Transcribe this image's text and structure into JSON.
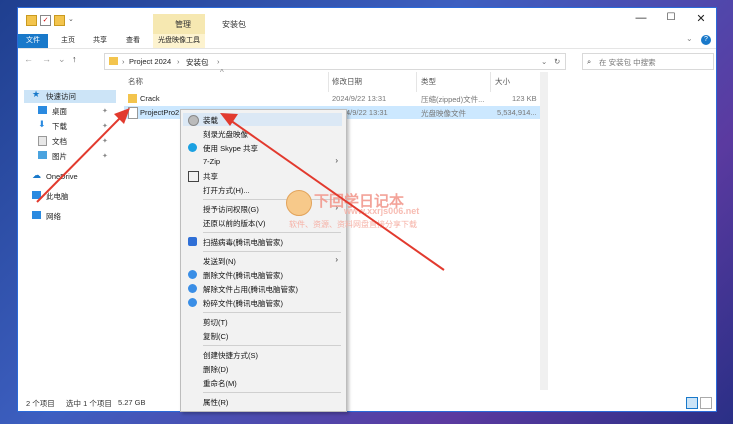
{
  "titlebar": {
    "ribbon_context_tab": "管理",
    "window_title": "安装包",
    "minimize": "—",
    "maximize": "☐",
    "close": "✕"
  },
  "ribbon": {
    "tabs": [
      "文件",
      "主页",
      "共享",
      "查看",
      "光盘映像工具"
    ],
    "help": "?"
  },
  "address": {
    "back": "←",
    "forward": "→",
    "up_history": "⌄",
    "up": "↑",
    "path": [
      "Project 2024",
      "安装包"
    ],
    "search_placeholder": "在 安装包 中搜索"
  },
  "sidebar": {
    "items": [
      {
        "label": "快速访问",
        "icon": "star-icon"
      },
      {
        "label": "桌面",
        "icon": "desktop-icon"
      },
      {
        "label": "下载",
        "icon": "download-icon"
      },
      {
        "label": "文档",
        "icon": "document-icon"
      },
      {
        "label": "图片",
        "icon": "picture-icon"
      },
      {
        "label": "OneDrive",
        "icon": "cloud-icon"
      },
      {
        "label": "此电脑",
        "icon": "computer-icon"
      },
      {
        "label": "网络",
        "icon": "network-icon"
      }
    ]
  },
  "columns": {
    "name": "名称",
    "modified": "修改日期",
    "type": "类型",
    "size": "大小"
  },
  "files": [
    {
      "name": "Crack",
      "modified": "2024/9/22 13:31",
      "type": "压缩(zipped)文件...",
      "size": "123 KB"
    },
    {
      "name": "ProjectPro2",
      "modified": "4/9/22 13:31",
      "type": "光盘映像文件",
      "size": "5,534,914..."
    }
  ],
  "status": {
    "count": "2 个项目",
    "selected": "选中 1 个项目",
    "size": "5.27 GB"
  },
  "context_menu": [
    {
      "label": "装载",
      "icon": "mount-icon"
    },
    {
      "label": "刻录光盘映像",
      "icon": ""
    },
    {
      "label": "使用 Skype 共享",
      "icon": "skype-icon"
    },
    {
      "label": "7-Zip",
      "icon": "",
      "submenu": true
    },
    {
      "label": "共享",
      "icon": "share-icon"
    },
    {
      "label": "打开方式(H)...",
      "icon": ""
    },
    {
      "sep": true
    },
    {
      "label": "授予访问权限(G)",
      "icon": "",
      "submenu": true
    },
    {
      "label": "还原以前的版本(V)",
      "icon": ""
    },
    {
      "sep": true
    },
    {
      "label": "扫描病毒(腾讯电脑管家)",
      "icon": "shield-icon"
    },
    {
      "sep": true
    },
    {
      "label": "发送到(N)",
      "icon": "",
      "submenu": true
    },
    {
      "label": "删除文件(腾讯电脑管家)",
      "icon": "tencent-icon"
    },
    {
      "label": "解除文件占用(腾讯电脑管家)",
      "icon": "tencent-icon"
    },
    {
      "label": "粉碎文件(腾讯电脑管家)",
      "icon": "tencent-icon"
    },
    {
      "sep": true
    },
    {
      "label": "剪切(T)",
      "icon": ""
    },
    {
      "label": "复制(C)",
      "icon": ""
    },
    {
      "sep": true
    },
    {
      "label": "创建快捷方式(S)",
      "icon": ""
    },
    {
      "label": "删除(D)",
      "icon": ""
    },
    {
      "label": "重命名(M)",
      "icon": ""
    },
    {
      "sep": true
    },
    {
      "label": "属性(R)",
      "icon": ""
    }
  ],
  "watermark": {
    "title": "下回学日记本",
    "sub": "软件、资源、资料网盘直接分享下载",
    "url": "www.xxrjs006.net"
  },
  "colors": {
    "accent": "#1979ca",
    "selection": "#cce8ff",
    "arrow": "#e23a2e"
  }
}
